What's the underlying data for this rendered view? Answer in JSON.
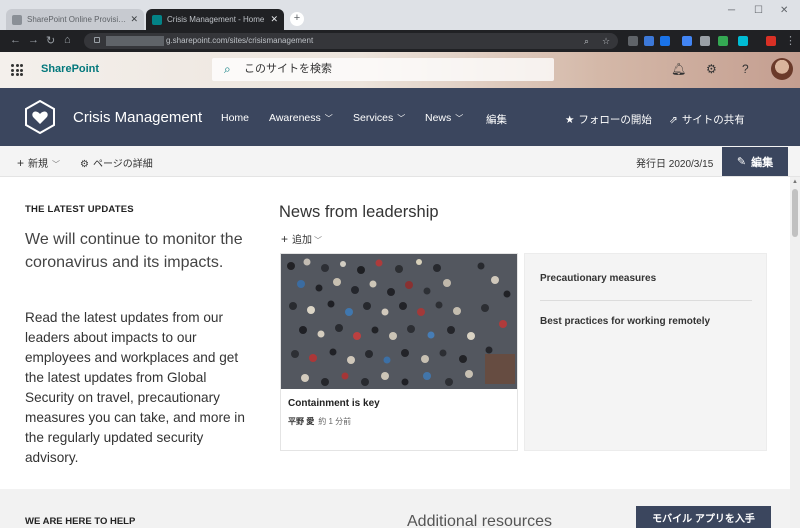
{
  "browser": {
    "tabs": [
      {
        "title": "SharePoint Online Provisioning...",
        "active": false
      },
      {
        "title": "Crisis Management - Home",
        "active": true
      }
    ],
    "url": "g.sharepoint.com/sites/crisismanagement"
  },
  "suite": {
    "brand": "SharePoint",
    "search_placeholder": "このサイトを検索"
  },
  "site": {
    "title": "Crisis Management",
    "nav": [
      "Home",
      "Awareness",
      "Services",
      "News",
      "編集"
    ],
    "follow_label": "フォローの開始",
    "share_label": "サイトの共有"
  },
  "commandbar": {
    "new_label": "新規",
    "page_details_label": "ページの詳細",
    "published": "発行日 2020/3/15",
    "edit_label": "編集"
  },
  "latest": {
    "heading": "THE LATEST UPDATES",
    "lead": "We will continue to monitor the coronavirus and its impacts.",
    "body": "Read the latest updates from our leaders about impacts to our employees and workplaces and get the latest updates from Global Security on travel, precautionary measures you can take, and more in the regularly updated security advisory."
  },
  "news": {
    "title": "News from leadership",
    "add_label": "追加",
    "card": {
      "title": "Containment is key",
      "author": "平野 愛",
      "time": "約 1 分前"
    },
    "list": [
      "Precautionary measures",
      "Best practices for working remotely"
    ]
  },
  "footer": {
    "help_heading": "WE ARE HERE TO HELP",
    "resources_heading": "Additional resources",
    "mobile_button": "モバイル アプリを入手"
  },
  "colors": {
    "site_header": "#3b465e",
    "brand_teal": "#03787c"
  }
}
